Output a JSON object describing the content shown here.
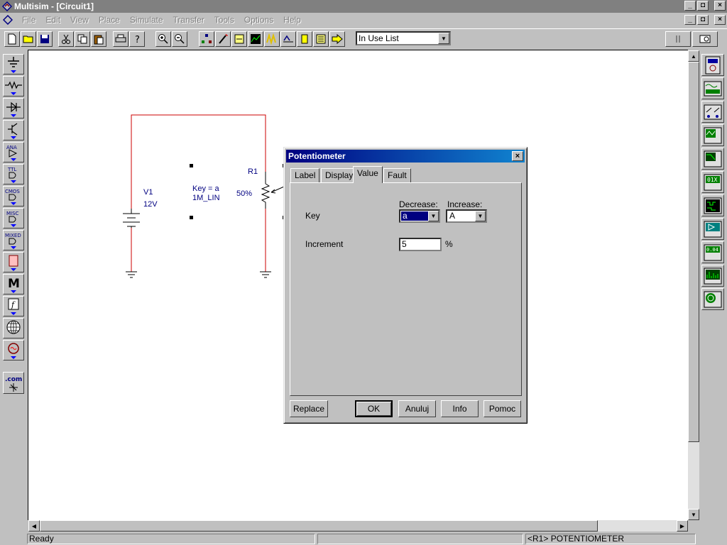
{
  "window": {
    "title": "Multisim - [Circuit1]",
    "minimize": "_",
    "maximize": "◘",
    "close": "×"
  },
  "menu": {
    "items": [
      "File",
      "Edit",
      "View",
      "Place",
      "Simulate",
      "Transfer",
      "Tools",
      "Options",
      "Help"
    ]
  },
  "toolbar": {
    "combo_value": "In Use List",
    "combo_arrow": "▼"
  },
  "schematic": {
    "v1_name": "V1",
    "v1_value": "12V",
    "r1_name": "R1",
    "r1_key": "Key = a",
    "r1_model": "1M_LIN",
    "r1_setting": "50%"
  },
  "dialog": {
    "title": "Potentiometer",
    "close": "×",
    "tabs": [
      "Label",
      "Display",
      "Value",
      "Fault"
    ],
    "key_label": "Key",
    "decrease_label": "Decrease:",
    "increase_label": "Increase:",
    "decrease_value": "a",
    "increase_value": "A",
    "increment_label": "Increment",
    "increment_value": "5",
    "increment_unit": "%",
    "buttons": {
      "replace": "Replace",
      "ok": "OK",
      "cancel": "Anuluj",
      "info": "Info",
      "help": "Pomoc"
    }
  },
  "status": {
    "text": "Ready",
    "component": "<R1> POTENTIOMETER"
  },
  "colors": {
    "wire_red": "#cc0000",
    "label_blue": "#000080",
    "title_active": "#000080"
  }
}
